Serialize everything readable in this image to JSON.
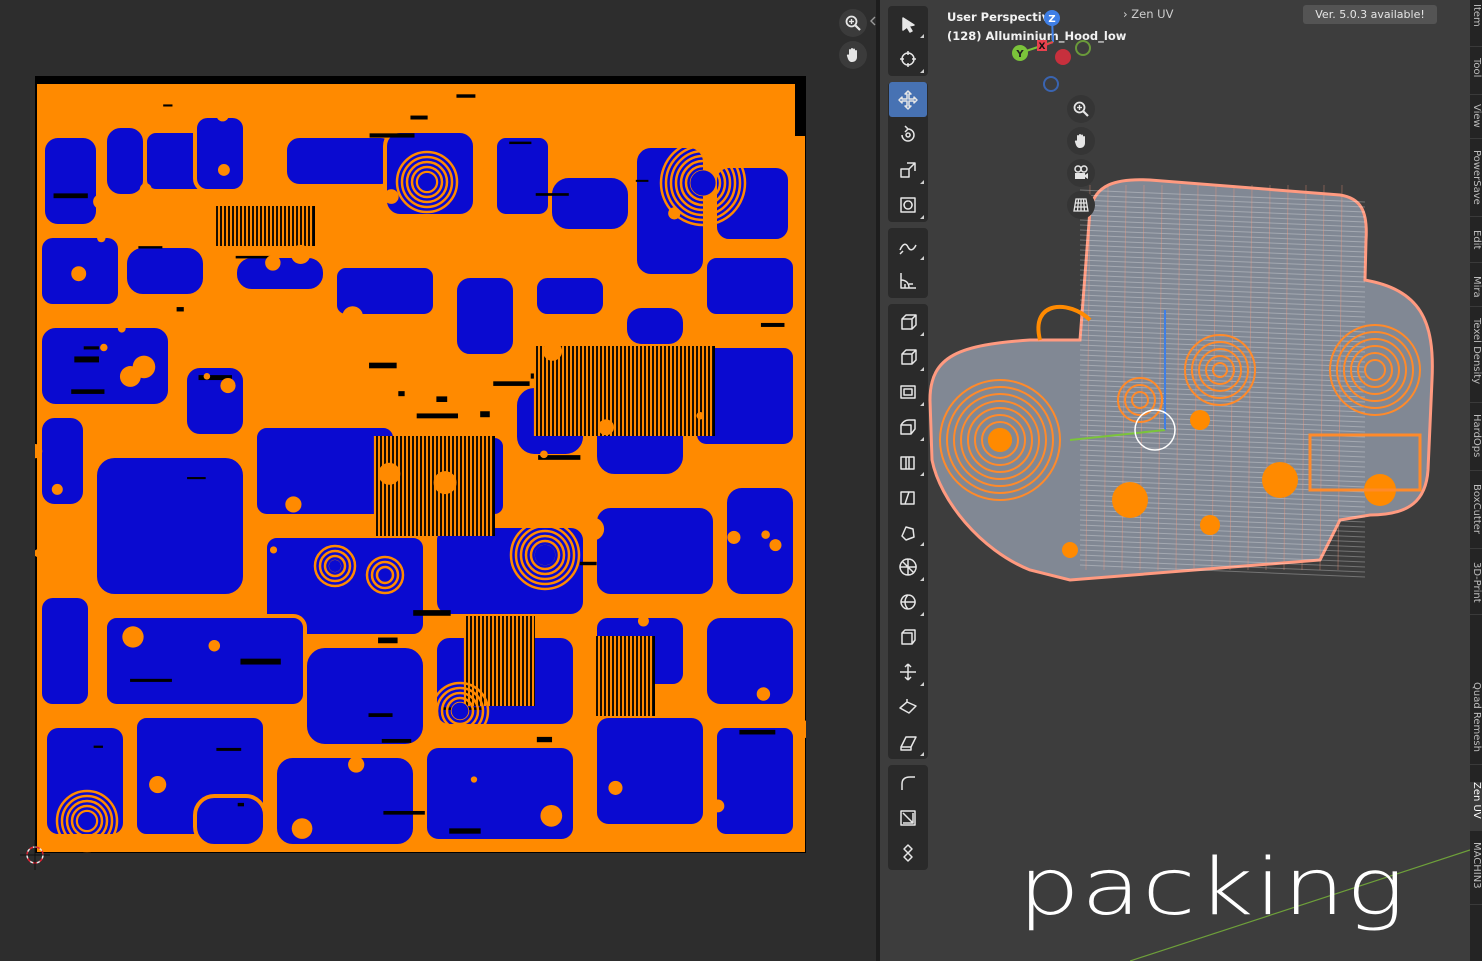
{
  "viewport": {
    "mode_label": "User Perspective",
    "object_label": "(128) Alluminium_Hood_low",
    "breadcrumb": "Zen UV",
    "version_notice": "Ver. 5.0.3 available!",
    "gizmo_axes": [
      "Z",
      "Y",
      "X"
    ],
    "caption": "packing"
  },
  "npanel_tabs": [
    "Item",
    "Tool",
    "View",
    "PowerSave",
    "Edit",
    "Mira",
    "Texel Density",
    "HardOps",
    "BoxCutter",
    "3D-Print",
    "Quad Remesh",
    "Zen UV",
    "MACHIN3"
  ],
  "active_tab": "Zen UV",
  "toolbar_tools": [
    "select-box",
    "cursor",
    "move",
    "rotate",
    "scale",
    "transform",
    "annotate",
    "measure",
    "add-cube",
    "extrude",
    "inset",
    "bevel",
    "loop-cut",
    "knife",
    "poly-build",
    "spin",
    "smooth",
    "edge-slide",
    "shrink-fatten",
    "shear",
    "rip",
    "uv-tool-a",
    "uv-tool-b",
    "uv-tool-c"
  ],
  "colors": {
    "uv_island_fill": "#0a0ad0",
    "uv_island_edge": "#ff8a00",
    "uv_background": "#000000",
    "active_tool": "#4772b3",
    "axis_x": "#e8414e",
    "axis_y": "#7bc43a",
    "axis_z": "#3f7fe6"
  }
}
